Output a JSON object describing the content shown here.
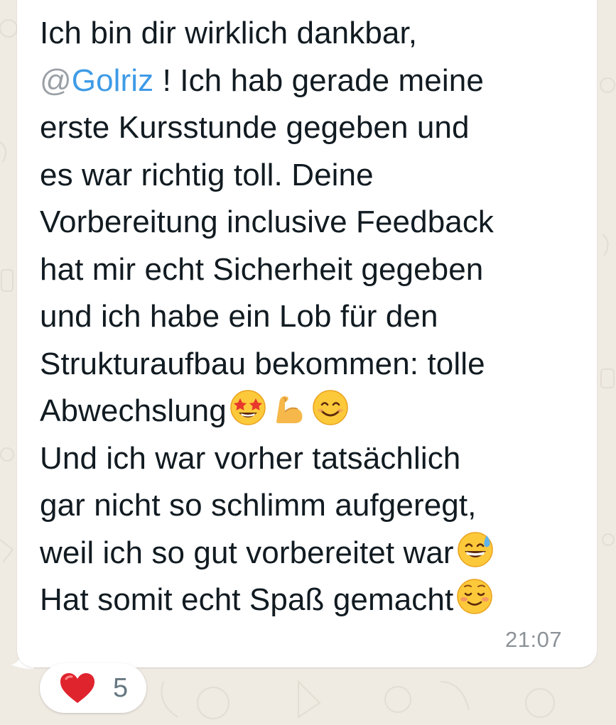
{
  "message": {
    "lines": [
      "Ich bin dir wirklich dankbar,",
      "! Ich hab gerade meine",
      "erste Kursstunde gegeben und",
      "es war richtig toll. Deine",
      "Vorbereitung inclusive Feedback",
      "hat mir echt Sicherheit gegeben",
      "und ich habe ein Lob für den",
      "Strukturaufbau bekommen: tolle",
      "Abwechslung",
      "Und ich war vorher tatsächlich",
      "gar nicht so schlimm aufgeregt,",
      "weil ich so gut vorbereitet war",
      "Hat somit echt Spaß gemacht"
    ],
    "mention_at": "@",
    "mention_name": "Golriz",
    "emojis": {
      "line9": [
        "star-struck-emoji",
        "flexed-biceps-emoji",
        "smiling-face-emoji"
      ],
      "line12": [
        "grinning-sweat-emoji"
      ],
      "line13": [
        "smiling-blush-emoji"
      ]
    },
    "timestamp": "21:07"
  },
  "reaction": {
    "emoji": "heart-icon",
    "count": "5"
  },
  "colors": {
    "background": "#efeae2",
    "bubble": "#ffffff",
    "text": "#111b21",
    "mention": "#3f9be6",
    "timestamp": "#8c9298",
    "heart": "#e0242e"
  }
}
